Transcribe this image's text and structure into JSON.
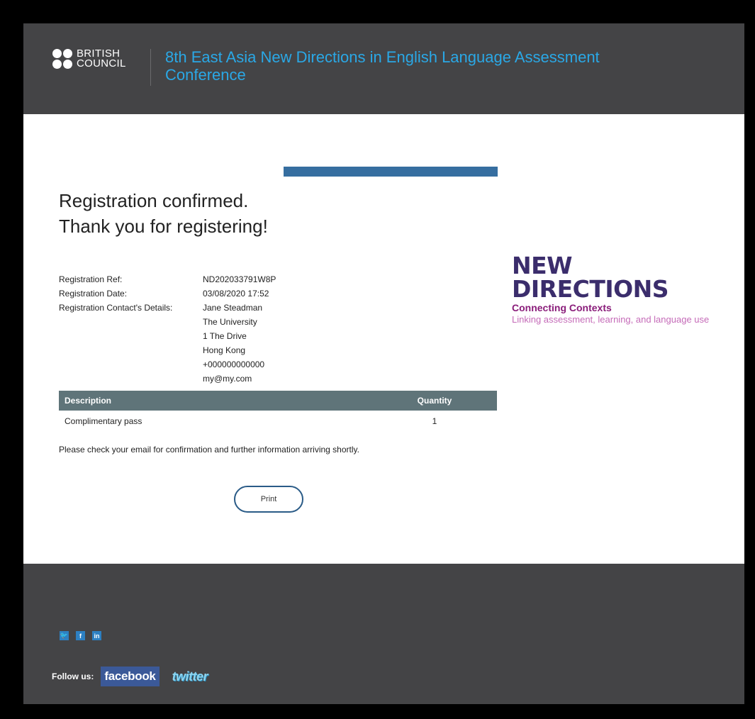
{
  "header": {
    "org_line1": "BRITISH",
    "org_line2": "COUNCIL",
    "conference_title": "8th East Asia New Directions in English Language Assessment Conference"
  },
  "confirmation": {
    "line1": "Registration confirmed.",
    "line2": "Thank you for registering!"
  },
  "details": {
    "ref_label": "Registration Ref:",
    "ref_value": "ND202033791W8P",
    "date_label": "Registration Date:",
    "date_value": "03/08/2020 17:52",
    "contact_label": "Registration Contact's Details:",
    "contact_lines": [
      "Jane Steadman",
      "The University",
      "1 The Drive",
      "Hong Kong",
      "+000000000000",
      "my@my.com"
    ]
  },
  "table": {
    "headers": [
      "Description",
      "Quantity"
    ],
    "rows": [
      {
        "description": "Complimentary pass",
        "quantity": "1"
      }
    ]
  },
  "notice": "Please check your email for confirmation and further information arriving shortly.",
  "print_label": "Print",
  "brand": {
    "line1": "NEW",
    "line2": "DIRECTIONS",
    "tagline1": "Connecting Contexts",
    "tagline2": "Linking assessment, learning, and language use"
  },
  "footer": {
    "icons": [
      "twitter-icon",
      "facebook-icon",
      "linkedin-icon"
    ],
    "follow_label": "Follow us:",
    "facebook_label": "facebook",
    "twitter_label": "twitter"
  },
  "colors": {
    "header_bg": "#444446",
    "title_blue": "#2aa8e6",
    "accent_bar": "#366ea0",
    "table_header": "#5f7479",
    "brand_purple": "#3b2d6c",
    "brand_magenta": "#8a1d7a"
  }
}
